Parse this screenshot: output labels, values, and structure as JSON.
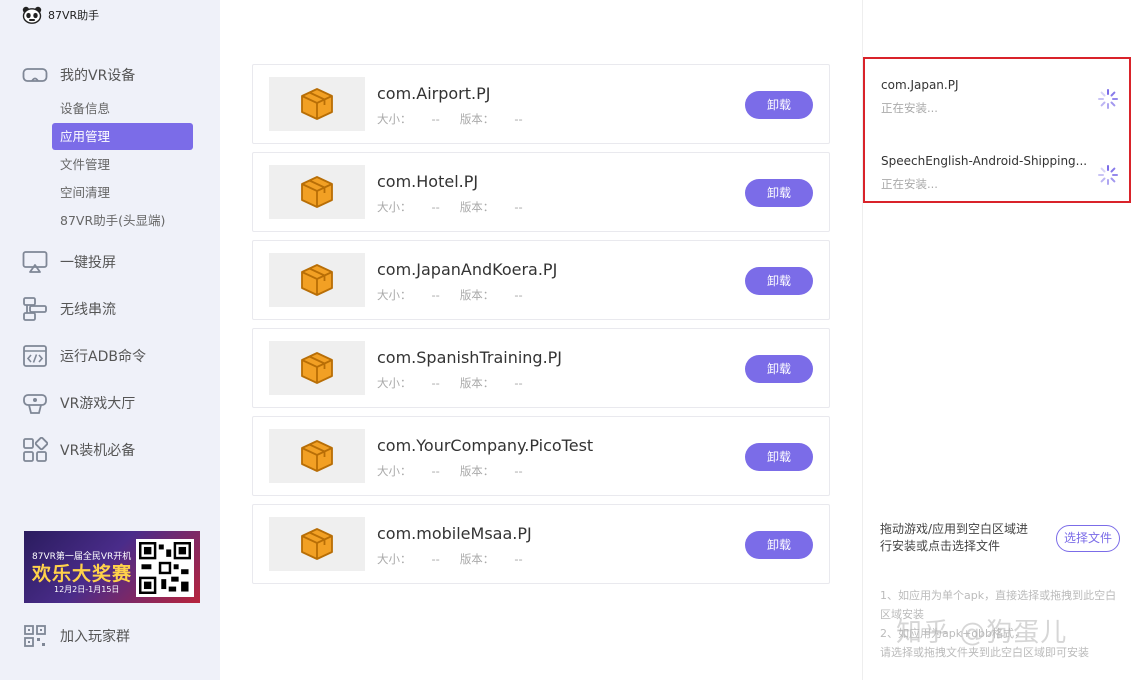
{
  "app": {
    "title": "87VR助手"
  },
  "sidebar": {
    "device_section": "我的VR设备",
    "sub_items": [
      "设备信息",
      "应用管理",
      "文件管理",
      "空间清理",
      "87VR助手(头显端)"
    ],
    "active_sub": 1,
    "items": [
      "一键投屏",
      "无线串流",
      "运行ADB命令",
      "VR游戏大厅",
      "VR装机必备"
    ],
    "promo": {
      "line1": "87VR第一届全民VR开机",
      "line2": "欢乐大奖赛",
      "line3": "12月2日-1月15日"
    },
    "join_group": "加入玩家群"
  },
  "apps": [
    {
      "name": "com.Airport.PJ",
      "size_label": "大小：",
      "size": "--",
      "version_label": "版本：",
      "version": "--",
      "action": "卸载"
    },
    {
      "name": "com.Hotel.PJ",
      "size_label": "大小：",
      "size": "--",
      "version_label": "版本：",
      "version": "--",
      "action": "卸载"
    },
    {
      "name": "com.JapanAndKoera.PJ",
      "size_label": "大小：",
      "size": "--",
      "version_label": "版本：",
      "version": "--",
      "action": "卸载"
    },
    {
      "name": "com.SpanishTraining.PJ",
      "size_label": "大小：",
      "size": "--",
      "version_label": "版本：",
      "version": "--",
      "action": "卸载"
    },
    {
      "name": "com.YourCompany.PicoTest",
      "size_label": "大小：",
      "size": "--",
      "version_label": "版本：",
      "version": "--",
      "action": "卸载"
    },
    {
      "name": "com.mobileMsaa.PJ",
      "size_label": "大小：",
      "size": "--",
      "version_label": "版本：",
      "version": "--",
      "action": "卸载"
    }
  ],
  "installing": [
    {
      "name": "com.Japan.PJ",
      "status": "正在安装..."
    },
    {
      "name": "SpeechEnglish-Android-Shipping...",
      "status": "正在安装..."
    }
  ],
  "drop": {
    "text": "拖动游戏/应用到空白区域进行安装或点击选择文件",
    "button": "选择文件",
    "notes": [
      "1、如应用为单个apk，直接选择或拖拽到此空白区域安装",
      "2、如应用为apk+obb格式，",
      "请选择或拖拽文件夹到此空白区域即可安装"
    ]
  },
  "watermark": "知乎 @狗蛋儿",
  "colors": {
    "accent": "#7b6ce8",
    "highlight": "#d9232a",
    "icon_box": "#f2a024"
  }
}
